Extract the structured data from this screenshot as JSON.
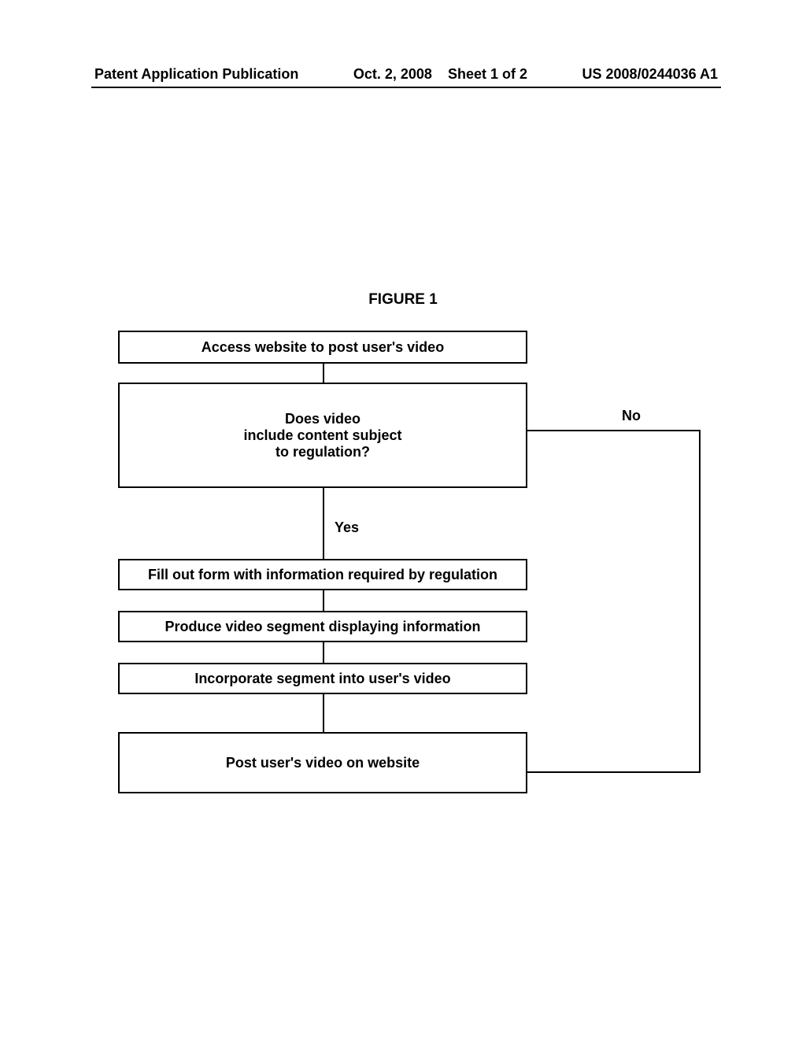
{
  "header": {
    "pub": "Patent Application Publication",
    "date": "Oct. 2, 2008",
    "sheet": "Sheet 1 of 2",
    "docnum": "US 2008/0244036 A1"
  },
  "figure_title": "FIGURE 1",
  "boxes": {
    "b1": "Access website to post user's video",
    "b2_l1": "Does video",
    "b2_l2": "include content subject",
    "b2_l3": "to regulation?",
    "b3": "Fill out form with information required by regulation",
    "b4": "Produce video segment displaying information",
    "b5": "Incorporate segment into user's video",
    "b6": "Post user's video on website"
  },
  "labels": {
    "yes": "Yes",
    "no": "No"
  },
  "chart_data": {
    "type": "flowchart",
    "title": "FIGURE 1",
    "nodes": [
      {
        "id": "n1",
        "text": "Access website to post user's video",
        "kind": "process"
      },
      {
        "id": "n2",
        "text": "Does video include content subject to regulation?",
        "kind": "decision"
      },
      {
        "id": "n3",
        "text": "Fill out form with information required by regulation",
        "kind": "process"
      },
      {
        "id": "n4",
        "text": "Produce video segment displaying information",
        "kind": "process"
      },
      {
        "id": "n5",
        "text": "Incorporate segment into user's video",
        "kind": "process"
      },
      {
        "id": "n6",
        "text": "Post user's video on website",
        "kind": "process"
      }
    ],
    "edges": [
      {
        "from": "n1",
        "to": "n2",
        "label": ""
      },
      {
        "from": "n2",
        "to": "n3",
        "label": "Yes"
      },
      {
        "from": "n2",
        "to": "n6",
        "label": "No"
      },
      {
        "from": "n3",
        "to": "n4",
        "label": ""
      },
      {
        "from": "n4",
        "to": "n5",
        "label": ""
      },
      {
        "from": "n5",
        "to": "n6",
        "label": ""
      }
    ]
  }
}
